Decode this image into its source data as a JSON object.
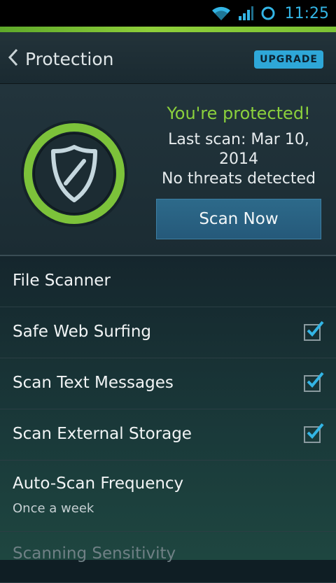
{
  "status_bar": {
    "time": "11:25"
  },
  "header": {
    "title": "Protection",
    "upgrade_label": "UPGRADE"
  },
  "status": {
    "headline": "You're protected!",
    "last_scan": "Last scan: Mar 10, 2014",
    "threats": "No threats detected",
    "scan_button": "Scan Now"
  },
  "settings": {
    "items": [
      {
        "label": "File Scanner"
      },
      {
        "label": "Safe Web Surfing",
        "checked": true
      },
      {
        "label": "Scan Text Messages",
        "checked": true
      },
      {
        "label": "Scan External Storage",
        "checked": true
      },
      {
        "label": "Auto-Scan Frequency",
        "value": "Once a week"
      },
      {
        "label": "Scanning Sensitivity"
      }
    ]
  },
  "colors": {
    "accent_green": "#8bd03c",
    "accent_blue": "#33b5e5",
    "upgrade_badge": "#2ea7d8",
    "scan_button": "#2a6484"
  },
  "icons": {
    "wifi": "wifi-icon",
    "signal": "signal-icon",
    "sync": "sync-icon",
    "back": "chevron-left-icon",
    "shield": "shield-icon",
    "check": "checkmark-icon"
  }
}
